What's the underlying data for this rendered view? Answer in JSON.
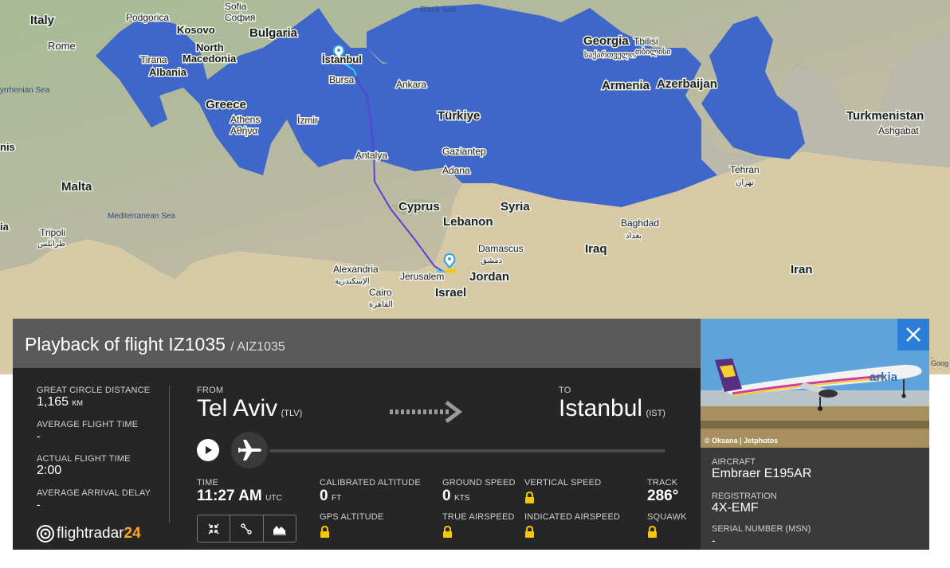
{
  "map": {
    "labels": {
      "italy": "Italy",
      "podgorica": "Podgorica",
      "sofia": "Sofia",
      "sofia_local": "София",
      "kosovo": "Kosovo",
      "bulgaria": "Bulgaria",
      "north_macedonia_1": "North",
      "north_macedonia_2": "Macedonia",
      "rome": "Rome",
      "tirana": "Tirana",
      "albania": "Albania",
      "istanbul": "İstanbul",
      "bursa": "Bursa",
      "black_sea": "Black Sea",
      "georgia": "Georgia",
      "georgia_local": "საქართველო",
      "tbilisi": "Tbilisi",
      "tbilisi_local": "თბილისი",
      "ankara": "Ankara",
      "armenia": "Armenia",
      "azerbaijan": "Azerbaijan",
      "greece": "Greece",
      "athens": "Athens",
      "athens_local": "Αθήνα",
      "izmir": "İzmir",
      "turkiye": "Türkiye",
      "turkmenistan": "Turkmenistan",
      "ashgabat": "Ashgabat",
      "tyrrhenian": "yrrhenian Sea",
      "antalya": "Antalya",
      "gaziantep": "Gaziantep",
      "adana": "Adana",
      "tehran": "Tehran",
      "tehran_local": "تهران",
      "malta": "Malta",
      "nis": "nis",
      "med_sea": "Mediterranean Sea",
      "cyprus": "Cyprus",
      "syria": "Syria",
      "lebanon": "Lebanon",
      "baghdad": "Baghdad",
      "baghdad_local": "بغداد",
      "tripoli": "Tripoli",
      "tripoli_local": "طرابلس",
      "damascus": "Damascus",
      "damascus_local": "دمشق",
      "iraq": "Iraq",
      "ia": "ia",
      "iran": "Iran",
      "alexandria": "Alexandria",
      "alexandria_local": "الإسكندرية",
      "jerusalem": "Jerusalem",
      "jordan": "Jordan",
      "cairo": "Cairo",
      "cairo_local": "القاهرة",
      "israel": "Israel"
    },
    "google_fragment": ", Goog",
    "colors": {
      "route": "#5b3fd6",
      "route_end": "#2bd0ff",
      "marker": "#2ea3e0",
      "sea": "#3f67c9",
      "land": "#9db58f"
    }
  },
  "panel": {
    "title": "Playback of flight IZ1035",
    "title_sub": "/ AIZ1035",
    "stats": [
      {
        "label": "GREAT CIRCLE DISTANCE",
        "value": "1,165",
        "unit": "KM"
      },
      {
        "label": "AVERAGE FLIGHT TIME",
        "value": "-"
      },
      {
        "label": "ACTUAL FLIGHT TIME",
        "value": "2:00"
      },
      {
        "label": "AVERAGE ARRIVAL DELAY",
        "value": "-"
      }
    ],
    "from_label": "FROM",
    "from_city": "Tel Aviv",
    "from_code": "(TLV)",
    "to_label": "TO",
    "to_city": "Istanbul",
    "to_code": "(IST)",
    "time_label": "TIME",
    "time_value": "11:27 AM",
    "time_unit": "UTC",
    "cal_alt_label": "CALIBRATED ALTITUDE",
    "cal_alt_value": "0",
    "cal_alt_unit": "FT",
    "gps_alt_label": "GPS ALTITUDE",
    "ground_speed_label": "GROUND SPEED",
    "ground_speed_value": "0",
    "ground_speed_unit": "KTS",
    "true_airspeed_label": "TRUE AIRSPEED",
    "vertical_speed_label": "VERTICAL SPEED",
    "indicated_airspeed_label": "INDICATED AIRSPEED",
    "track_label": "TRACK",
    "track_value": "286°",
    "squawk_label": "SQUAWK",
    "logo_text": "flightradar",
    "logo_num": "24",
    "playback_progress": 0
  },
  "side": {
    "photo_credit": "© Oksana | Jetphotos",
    "airline_livery_text": "arkia",
    "aircraft_label": "AIRCRAFT",
    "aircraft_value": "Embraer E195AR",
    "registration_label": "REGISTRATION",
    "registration_value": "4X-EMF",
    "serial_label": "SERIAL NUMBER (MSN)",
    "serial_value": "-"
  }
}
